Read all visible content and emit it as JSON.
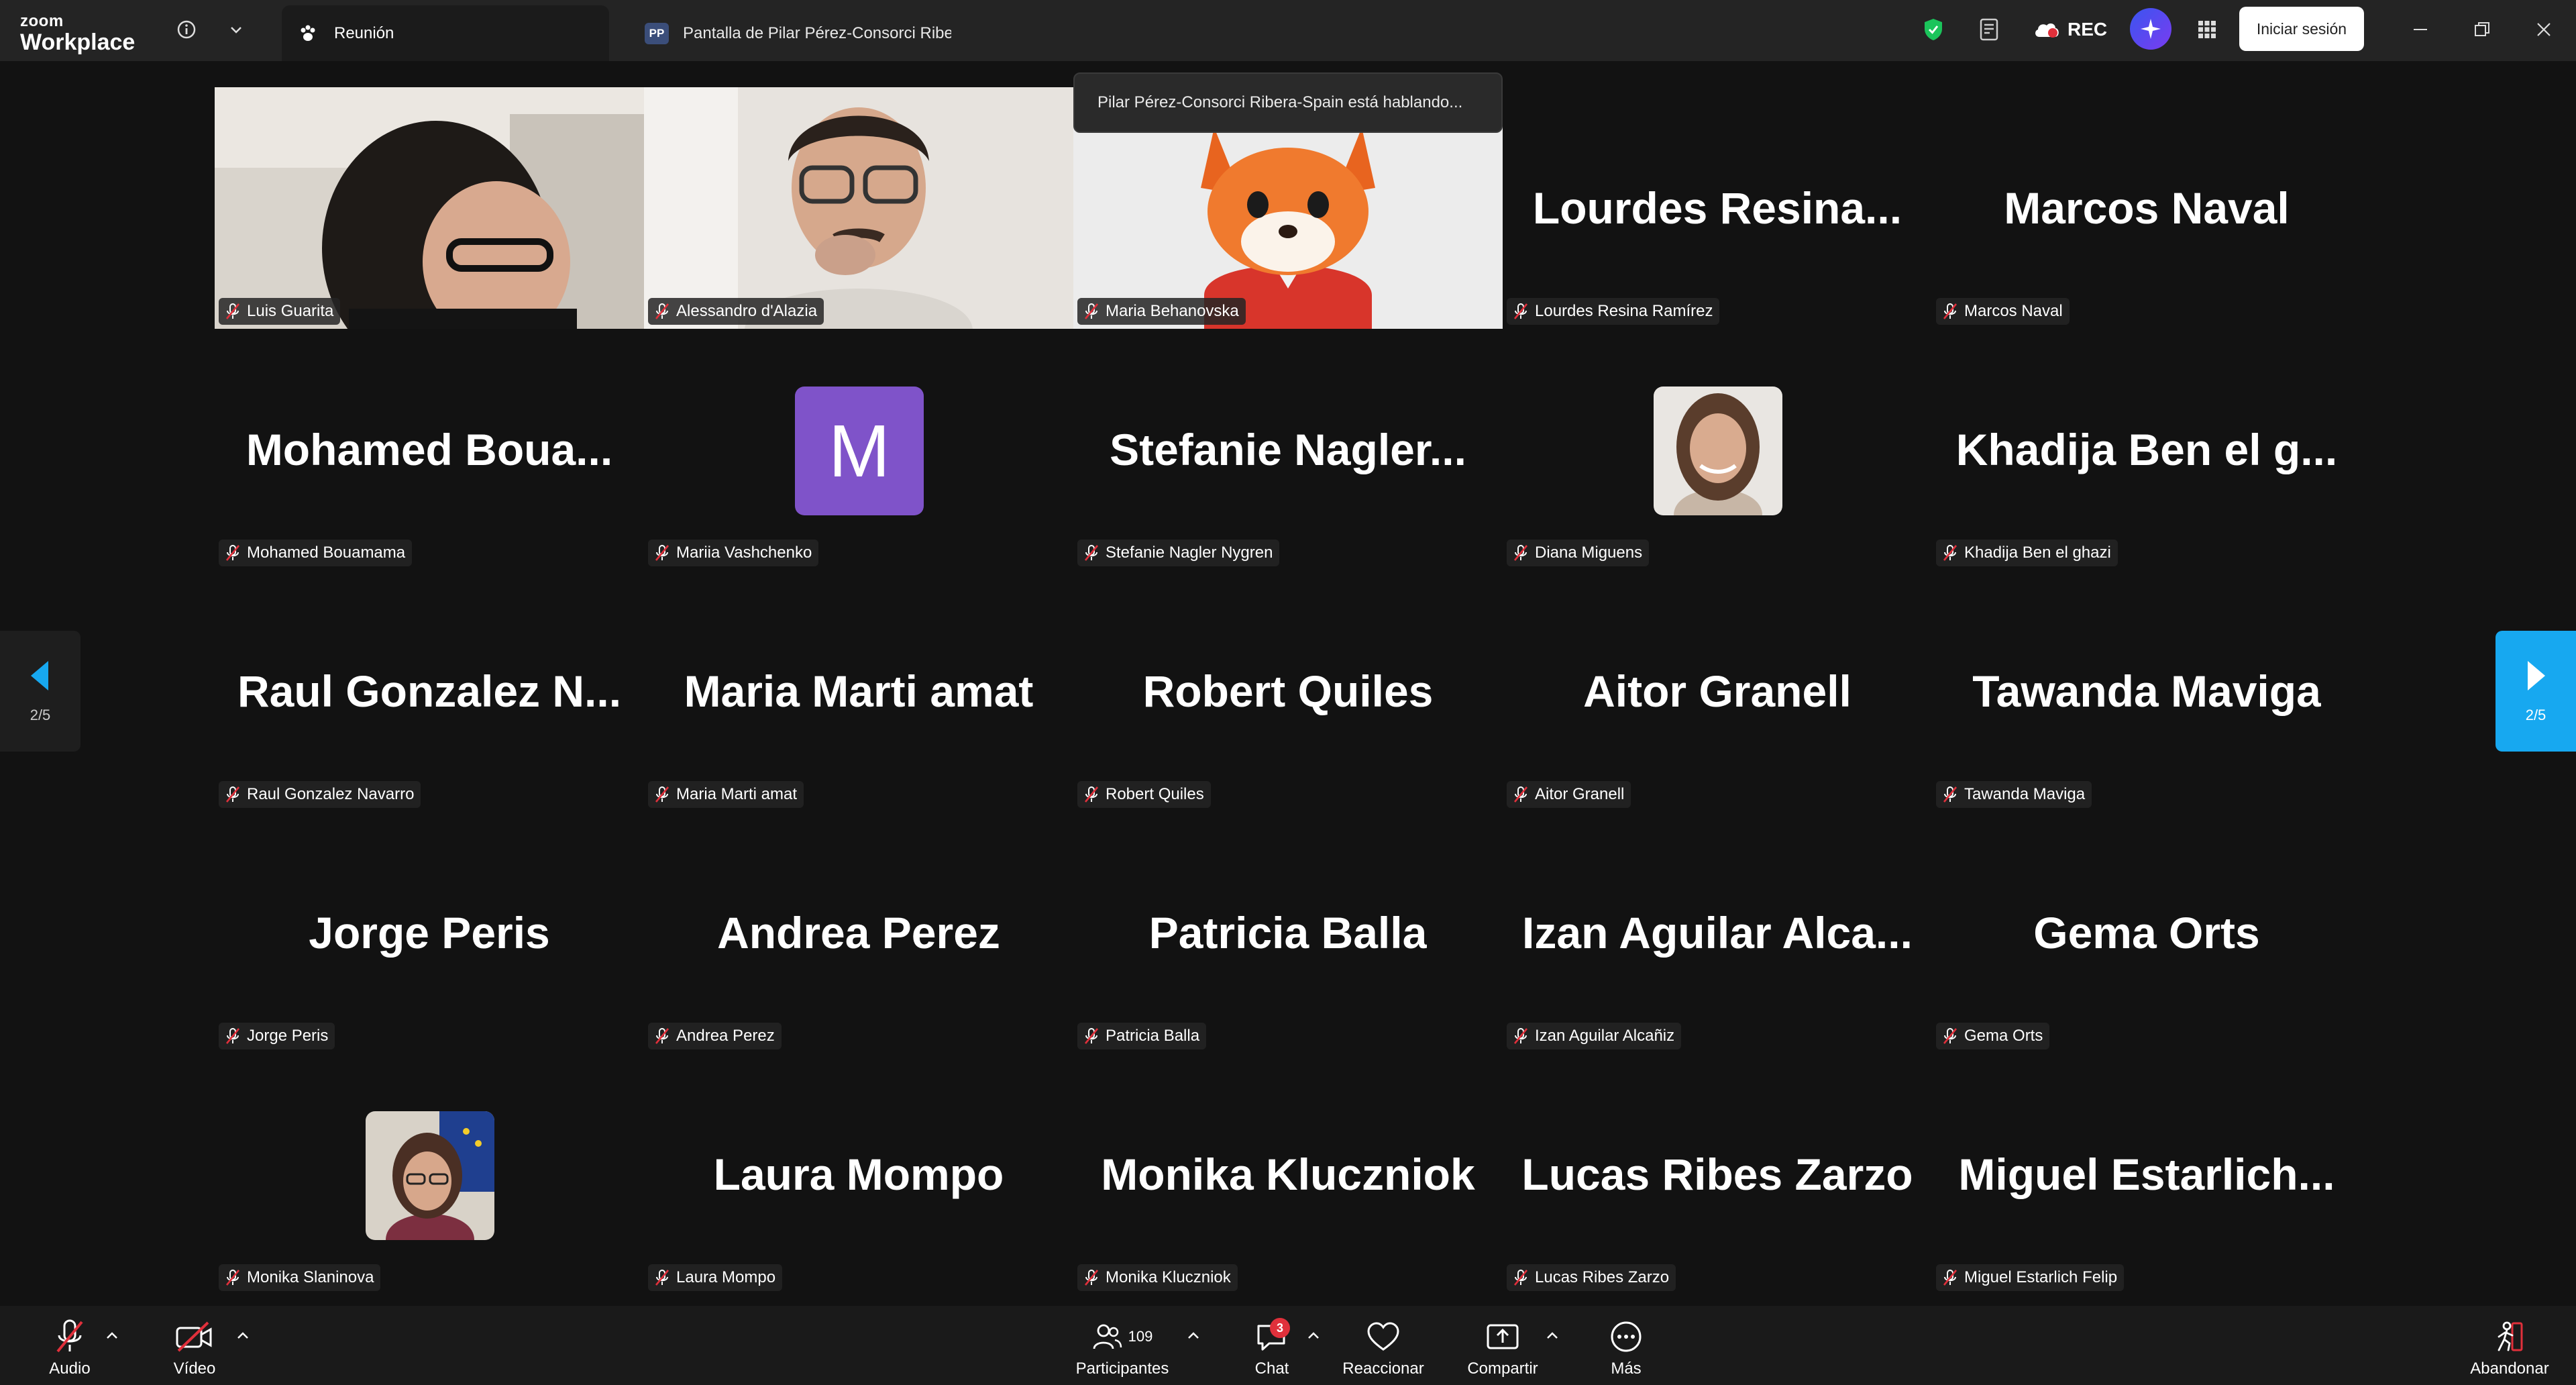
{
  "app": {
    "brand_small": "zoom",
    "brand_large": "Workplace"
  },
  "tabs": [
    {
      "label": "Reunión"
    },
    {
      "label": "Pantalla de Pilar Pérez-Consorci Ribera",
      "badge": "PP"
    }
  ],
  "header": {
    "rec_label": "REC",
    "signin_label": "Iniciar sesión"
  },
  "speaking_banner": "Pilar Pérez-Consorci Ribera-Spain está hablando...",
  "pager": {
    "page_left": "2/5",
    "page_right": "2/5"
  },
  "participants": [
    {
      "big": "",
      "tag": "Luis Guarita",
      "kind": "video"
    },
    {
      "big": "",
      "tag": "Alessandro d'Alazia",
      "kind": "video"
    },
    {
      "big": "",
      "tag": "Maria Behanovska",
      "kind": "video"
    },
    {
      "big": "Lourdes Resina...",
      "tag": "Lourdes Resina Ramírez",
      "kind": "name"
    },
    {
      "big": "Marcos Naval",
      "tag": "Marcos Naval",
      "kind": "name"
    },
    {
      "big": "Mohamed Boua...",
      "tag": "Mohamed Bouamama",
      "kind": "name"
    },
    {
      "big": "M",
      "tag": "Mariia Vashchenko",
      "kind": "letter"
    },
    {
      "big": "Stefanie Nagler...",
      "tag": "Stefanie Nagler Nygren",
      "kind": "name"
    },
    {
      "big": "",
      "tag": "Diana Miguens",
      "kind": "photo"
    },
    {
      "big": "Khadija Ben el g...",
      "tag": "Khadija Ben el ghazi",
      "kind": "name"
    },
    {
      "big": "Raul Gonzalez N...",
      "tag": "Raul Gonzalez Navarro",
      "kind": "name"
    },
    {
      "big": "Maria Marti amat",
      "tag": "Maria Marti amat",
      "kind": "name"
    },
    {
      "big": "Robert Quiles",
      "tag": "Robert Quiles",
      "kind": "name"
    },
    {
      "big": "Aitor Granell",
      "tag": "Aitor Granell",
      "kind": "name"
    },
    {
      "big": "Tawanda Maviga",
      "tag": "Tawanda Maviga",
      "kind": "name"
    },
    {
      "big": "Jorge Peris",
      "tag": "Jorge Peris",
      "kind": "name"
    },
    {
      "big": "Andrea Perez",
      "tag": "Andrea Perez",
      "kind": "name"
    },
    {
      "big": "Patricia Balla",
      "tag": "Patricia Balla",
      "kind": "name"
    },
    {
      "big": "Izan Aguilar Alca...",
      "tag": "Izan Aguilar Alcañiz",
      "kind": "name"
    },
    {
      "big": "Gema Orts",
      "tag": "Gema Orts",
      "kind": "name"
    },
    {
      "big": "",
      "tag": "Monika Slaninova",
      "kind": "photo2"
    },
    {
      "big": "Laura Mompo",
      "tag": "Laura Mompo",
      "kind": "name"
    },
    {
      "big": "Monika Kluczniok",
      "tag": "Monika Kluczniok",
      "kind": "name"
    },
    {
      "big": "Lucas Ribes Zarzo",
      "tag": "Lucas Ribes Zarzo",
      "kind": "name"
    },
    {
      "big": "Miguel Estarlich...",
      "tag": "Miguel Estarlich Felip",
      "kind": "name"
    }
  ],
  "toolbar": {
    "audio": "Audio",
    "video": "Vídeo",
    "participants": "Participantes",
    "participants_count": "109",
    "chat": "Chat",
    "chat_badge": "3",
    "react": "Reaccionar",
    "share": "Compartir",
    "more": "Más",
    "leave": "Abandonar"
  },
  "colors": {
    "accent_blue": "#17a8f0",
    "letter_avatar": "#7f53c9",
    "danger": "#e0303b",
    "shield": "#1bc45b"
  }
}
